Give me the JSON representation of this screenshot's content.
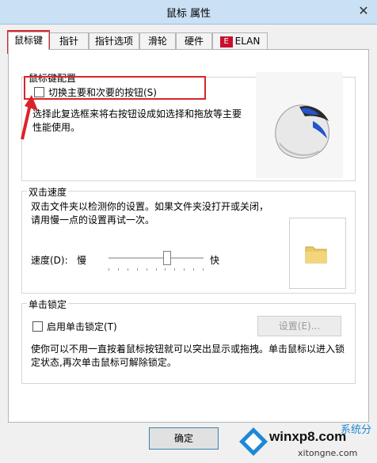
{
  "window": {
    "title": "鼠标 属性",
    "close": "✕"
  },
  "tabs": [
    {
      "label": "鼠标键",
      "active": true
    },
    {
      "label": "指针"
    },
    {
      "label": "指针选项"
    },
    {
      "label": "滑轮"
    },
    {
      "label": "硬件"
    },
    {
      "label": "ELAN"
    }
  ],
  "buttons_config": {
    "title": "鼠标键配置",
    "switch_checkbox": {
      "label": "切换主要和次要的按钮(S)",
      "checked": false
    },
    "description": "选择此复选框来将右按钮设成如选择和拖放等主要性能使用。"
  },
  "double_click": {
    "title": "双击速度",
    "description": "双击文件夹以检测你的设置。如果文件夹没打开或关闭，请用慢一点的设置再试一次。",
    "speed_label": "速度(D):",
    "slow": "慢",
    "fast": "快",
    "speed_level": 0.62
  },
  "click_lock": {
    "title": "单击锁定",
    "checkbox": {
      "label": "启用单击锁定(T)",
      "checked": false
    },
    "settings_button": "设置(E)...",
    "description": "使你可以不用一直按着鼠标按钮就可以突出显示或拖拽。单击鼠标以进入锁定状态,再次单击鼠标可解除锁定。"
  },
  "footer": {
    "ok_button": "确定"
  },
  "watermark": {
    "brand": "winxp8.com",
    "sub": "系统分",
    "url": "xitongne.com"
  },
  "colors": {
    "highlight": "#d9242a",
    "titlebar": "#c9e0f5"
  }
}
